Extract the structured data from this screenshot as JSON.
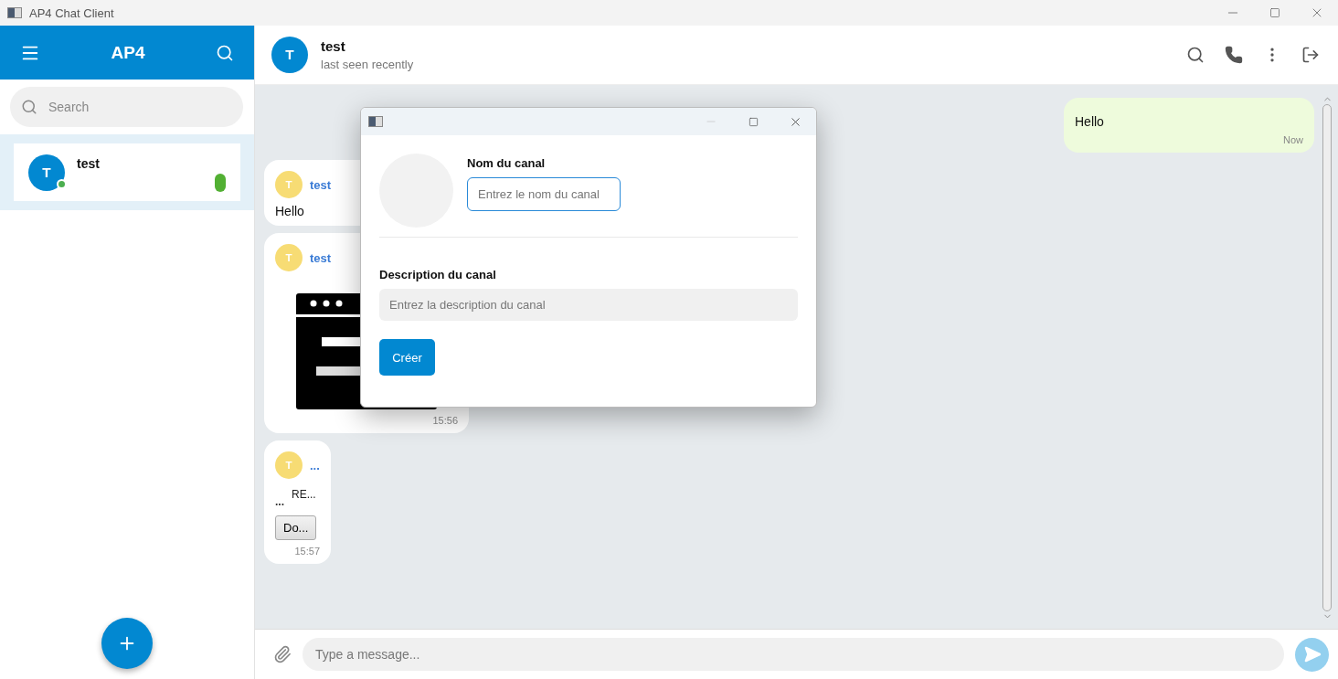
{
  "window": {
    "title": "AP4 Chat Client"
  },
  "sidebar": {
    "title": "AP4",
    "search": {
      "placeholder": "Search"
    },
    "chats": [
      {
        "name": "test",
        "avatar": "T",
        "online": true,
        "unread": true,
        "selected": true
      }
    ]
  },
  "chat": {
    "avatar": "T",
    "name": "test",
    "status": "last seen recently"
  },
  "messages": [
    {
      "outgoing": true,
      "kind": "text",
      "text": "Hello",
      "time": "Now"
    },
    {
      "outgoing": false,
      "kind": "text",
      "sender": "test",
      "avatar": "T",
      "text": "Hello"
    },
    {
      "outgoing": false,
      "sender": "test",
      "avatar": "T",
      "time": "15:56"
    },
    {
      "outgoing": false,
      "kind": "file",
      "sender": "...",
      "avatar": "T",
      "file_name": "RE...",
      "file_icon": "...",
      "button": "Do...",
      "time": "15:57"
    }
  ],
  "composer": {
    "placeholder": "Type a message..."
  },
  "dialog": {
    "name_label": "Nom du canal",
    "name_placeholder": "Entrez le nom du canal",
    "description_label": "Description du canal",
    "description_placeholder": "Entrez la description du canal",
    "submit": "Créer"
  }
}
